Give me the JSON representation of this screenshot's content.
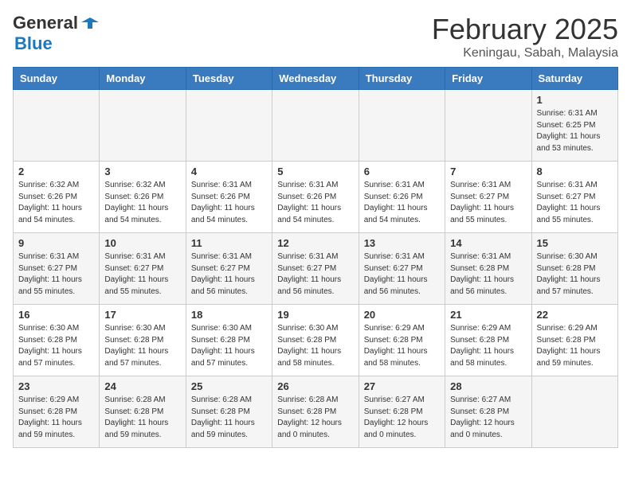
{
  "header": {
    "logo_line1": "General",
    "logo_line2": "Blue",
    "month": "February 2025",
    "location": "Keningau, Sabah, Malaysia"
  },
  "days_of_week": [
    "Sunday",
    "Monday",
    "Tuesday",
    "Wednesday",
    "Thursday",
    "Friday",
    "Saturday"
  ],
  "weeks": [
    {
      "days": [
        {
          "num": "",
          "info": ""
        },
        {
          "num": "",
          "info": ""
        },
        {
          "num": "",
          "info": ""
        },
        {
          "num": "",
          "info": ""
        },
        {
          "num": "",
          "info": ""
        },
        {
          "num": "",
          "info": ""
        },
        {
          "num": "1",
          "info": "Sunrise: 6:31 AM\nSunset: 6:25 PM\nDaylight: 11 hours\nand 53 minutes."
        }
      ]
    },
    {
      "days": [
        {
          "num": "2",
          "info": "Sunrise: 6:32 AM\nSunset: 6:26 PM\nDaylight: 11 hours\nand 54 minutes."
        },
        {
          "num": "3",
          "info": "Sunrise: 6:32 AM\nSunset: 6:26 PM\nDaylight: 11 hours\nand 54 minutes."
        },
        {
          "num": "4",
          "info": "Sunrise: 6:31 AM\nSunset: 6:26 PM\nDaylight: 11 hours\nand 54 minutes."
        },
        {
          "num": "5",
          "info": "Sunrise: 6:31 AM\nSunset: 6:26 PM\nDaylight: 11 hours\nand 54 minutes."
        },
        {
          "num": "6",
          "info": "Sunrise: 6:31 AM\nSunset: 6:26 PM\nDaylight: 11 hours\nand 54 minutes."
        },
        {
          "num": "7",
          "info": "Sunrise: 6:31 AM\nSunset: 6:27 PM\nDaylight: 11 hours\nand 55 minutes."
        },
        {
          "num": "8",
          "info": "Sunrise: 6:31 AM\nSunset: 6:27 PM\nDaylight: 11 hours\nand 55 minutes."
        }
      ]
    },
    {
      "days": [
        {
          "num": "9",
          "info": "Sunrise: 6:31 AM\nSunset: 6:27 PM\nDaylight: 11 hours\nand 55 minutes."
        },
        {
          "num": "10",
          "info": "Sunrise: 6:31 AM\nSunset: 6:27 PM\nDaylight: 11 hours\nand 55 minutes."
        },
        {
          "num": "11",
          "info": "Sunrise: 6:31 AM\nSunset: 6:27 PM\nDaylight: 11 hours\nand 56 minutes."
        },
        {
          "num": "12",
          "info": "Sunrise: 6:31 AM\nSunset: 6:27 PM\nDaylight: 11 hours\nand 56 minutes."
        },
        {
          "num": "13",
          "info": "Sunrise: 6:31 AM\nSunset: 6:27 PM\nDaylight: 11 hours\nand 56 minutes."
        },
        {
          "num": "14",
          "info": "Sunrise: 6:31 AM\nSunset: 6:28 PM\nDaylight: 11 hours\nand 56 minutes."
        },
        {
          "num": "15",
          "info": "Sunrise: 6:30 AM\nSunset: 6:28 PM\nDaylight: 11 hours\nand 57 minutes."
        }
      ]
    },
    {
      "days": [
        {
          "num": "16",
          "info": "Sunrise: 6:30 AM\nSunset: 6:28 PM\nDaylight: 11 hours\nand 57 minutes."
        },
        {
          "num": "17",
          "info": "Sunrise: 6:30 AM\nSunset: 6:28 PM\nDaylight: 11 hours\nand 57 minutes."
        },
        {
          "num": "18",
          "info": "Sunrise: 6:30 AM\nSunset: 6:28 PM\nDaylight: 11 hours\nand 57 minutes."
        },
        {
          "num": "19",
          "info": "Sunrise: 6:30 AM\nSunset: 6:28 PM\nDaylight: 11 hours\nand 58 minutes."
        },
        {
          "num": "20",
          "info": "Sunrise: 6:29 AM\nSunset: 6:28 PM\nDaylight: 11 hours\nand 58 minutes."
        },
        {
          "num": "21",
          "info": "Sunrise: 6:29 AM\nSunset: 6:28 PM\nDaylight: 11 hours\nand 58 minutes."
        },
        {
          "num": "22",
          "info": "Sunrise: 6:29 AM\nSunset: 6:28 PM\nDaylight: 11 hours\nand 59 minutes."
        }
      ]
    },
    {
      "days": [
        {
          "num": "23",
          "info": "Sunrise: 6:29 AM\nSunset: 6:28 PM\nDaylight: 11 hours\nand 59 minutes."
        },
        {
          "num": "24",
          "info": "Sunrise: 6:28 AM\nSunset: 6:28 PM\nDaylight: 11 hours\nand 59 minutes."
        },
        {
          "num": "25",
          "info": "Sunrise: 6:28 AM\nSunset: 6:28 PM\nDaylight: 11 hours\nand 59 minutes."
        },
        {
          "num": "26",
          "info": "Sunrise: 6:28 AM\nSunset: 6:28 PM\nDaylight: 12 hours\nand 0 minutes."
        },
        {
          "num": "27",
          "info": "Sunrise: 6:27 AM\nSunset: 6:28 PM\nDaylight: 12 hours\nand 0 minutes."
        },
        {
          "num": "28",
          "info": "Sunrise: 6:27 AM\nSunset: 6:28 PM\nDaylight: 12 hours\nand 0 minutes."
        },
        {
          "num": "",
          "info": ""
        }
      ]
    }
  ]
}
